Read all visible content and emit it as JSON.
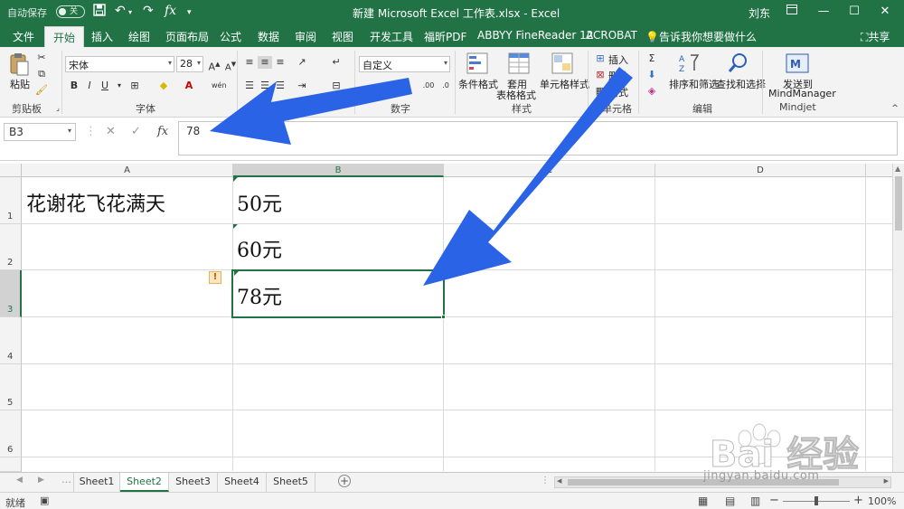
{
  "titlebar": {
    "autosave": "自动保存",
    "autosave_state": "关",
    "doc_title": "新建 Microsoft Excel 工作表.xlsx  -  Excel",
    "user": "刘东"
  },
  "tabs": [
    "文件",
    "开始",
    "插入",
    "绘图",
    "页面布局",
    "公式",
    "数据",
    "审阅",
    "视图",
    "开发工具",
    "福昕PDF",
    "ABBYY FineReader 12",
    "ACROBAT"
  ],
  "active_tab": "开始",
  "tell_me": "告诉我你想要做什么",
  "share": "共享",
  "ribbon": {
    "clipboard": {
      "paste": "粘贴",
      "label": "剪贴板"
    },
    "font": {
      "name": "宋体",
      "size": "28",
      "label": "字体",
      "bold": "B",
      "italic": "I",
      "underline": "U"
    },
    "alignment": {
      "label": "对齐方式"
    },
    "number": {
      "format": "自定义",
      "label": "数字"
    },
    "styles": {
      "conditional": "条件格式",
      "table1": "套用",
      "table2": "表格格式",
      "cell_styles": "单元格样式",
      "label": "样式"
    },
    "cells": {
      "insert": "插入",
      "delete": "删除",
      "format": "格式",
      "label": "单元格"
    },
    "editing": {
      "sort": "排序和筛选",
      "find": "查找和选择",
      "label": "编辑"
    },
    "mindjet": {
      "send1": "发送到",
      "send2": "MindManager",
      "label": "Mindjet"
    }
  },
  "formula_bar": {
    "name_box": "B3",
    "cancel": "✕",
    "enter": "✓",
    "fx": "fx",
    "value": "78"
  },
  "columns": [
    "A",
    "B",
    "C",
    "D"
  ],
  "rows": [
    "1",
    "2",
    "3",
    "4",
    "5",
    "6"
  ],
  "cells": {
    "A1": "花谢花飞花满天",
    "B1": "50元",
    "B2": "60元",
    "B3": "78元"
  },
  "sheets": [
    "Sheet1",
    "Sheet2",
    "Sheet3",
    "Sheet4",
    "Sheet5"
  ],
  "active_sheet": "Sheet2",
  "status": {
    "mode": "就绪",
    "zoom": "100%"
  },
  "watermark": {
    "text": "Bai 经验",
    "url": "jingyan.baidu.com"
  },
  "colors": {
    "excel_green": "#217346",
    "arrow_blue": "#2b63e6"
  }
}
